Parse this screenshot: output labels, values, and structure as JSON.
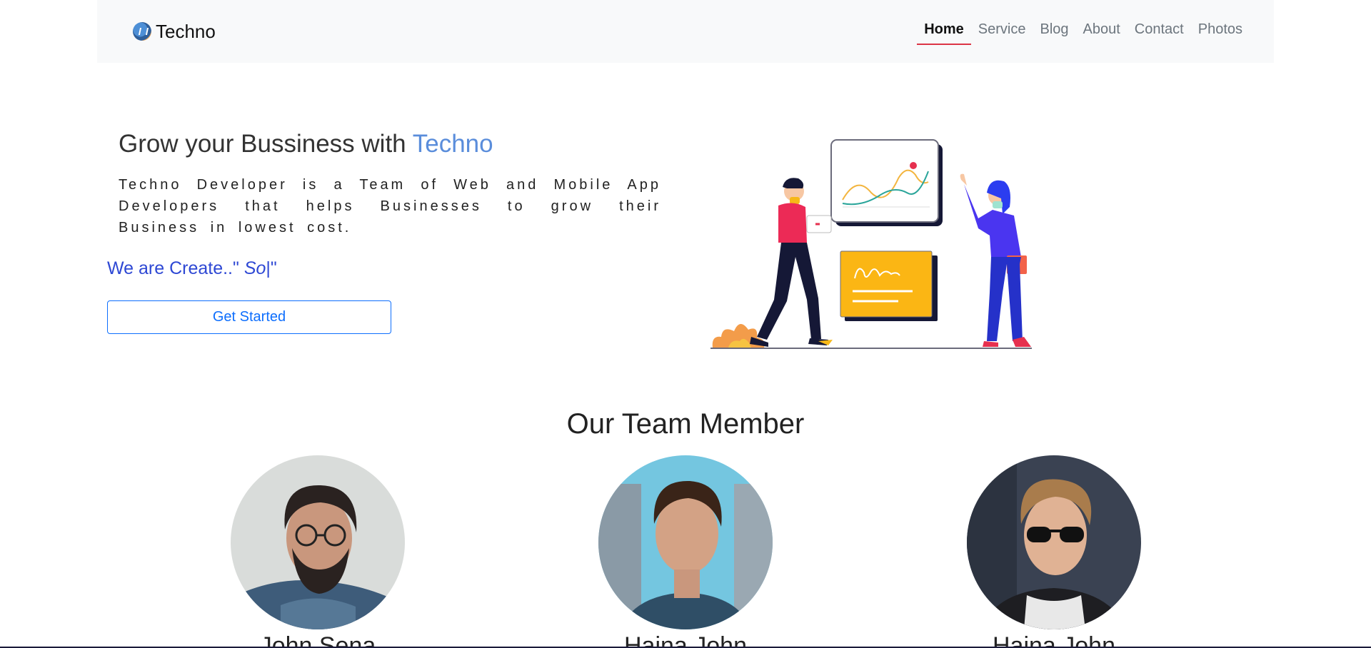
{
  "brand": {
    "name": "Techno"
  },
  "nav": {
    "items": [
      {
        "label": "Home",
        "active": true
      },
      {
        "label": "Service"
      },
      {
        "label": "Blog"
      },
      {
        "label": "About"
      },
      {
        "label": "Contact"
      },
      {
        "label": "Photos"
      }
    ]
  },
  "hero": {
    "title_prefix": "Grow your Bussiness with ",
    "title_accent": "Techno",
    "description": "Techno Developer is a Team of Web and Mobile App Developers that helps Businesses to grow their Business in lowest cost.",
    "typed_prefix": "We are Create..\" ",
    "typed_word": "So",
    "typed_caret": "|",
    "typed_suffix": "\"",
    "cta_label": "Get Started"
  },
  "team": {
    "title": "Our Team Member",
    "members": [
      {
        "name": "John Sena"
      },
      {
        "name": "Hajna John"
      },
      {
        "name": "Hajna John"
      }
    ]
  },
  "colors": {
    "accent": "#5a8ddb",
    "typed": "#2e48d4",
    "primary": "#0d6efd",
    "nav_active_underline": "#dc3545"
  }
}
